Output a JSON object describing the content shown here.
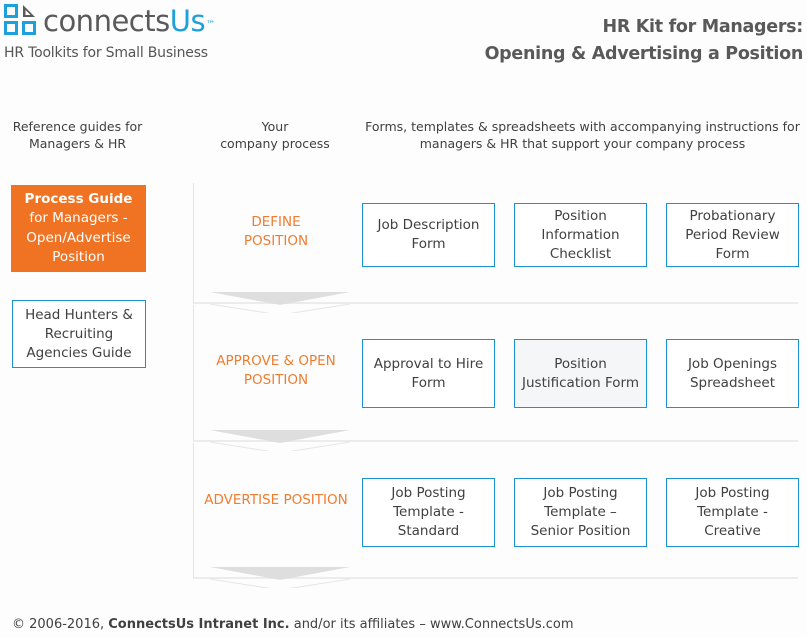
{
  "brand": {
    "name_prefix": "connects",
    "name_suffix": "Us",
    "trademark": "™",
    "tagline": "HR Toolkits for Small Business",
    "colors": {
      "blue": "#1ea0dc",
      "gray": "#5a5a5a"
    }
  },
  "header": {
    "title_line1": "HR Kit for Managers:",
    "title_line2": "Opening & Advertising a Position"
  },
  "column_headers": {
    "reference": [
      "Reference guides for",
      "Managers & HR"
    ],
    "process": [
      "Your",
      "company process"
    ],
    "forms": [
      "Forms, templates & spreadsheets with accompanying instructions for",
      "managers & HR that support your company process"
    ]
  },
  "reference_guides": {
    "primary": {
      "bold_line": "Process Guide",
      "lines": [
        "for Managers -",
        "Open/Advertise",
        "Position"
      ],
      "color": "#f07323"
    },
    "secondary": {
      "lines": [
        "Head Hunters &",
        "Recruiting",
        "Agencies Guide"
      ]
    }
  },
  "steps": [
    {
      "label_lines": [
        "DEFINE",
        "POSITION"
      ],
      "documents": [
        {
          "lines": [
            "Job Description",
            "Form"
          ]
        },
        {
          "lines": [
            "Position",
            "Information",
            "Checklist"
          ]
        },
        {
          "lines": [
            "Probationary",
            "Period Review",
            "Form"
          ]
        }
      ]
    },
    {
      "label_lines": [
        "APPROVE & OPEN",
        "POSITION"
      ],
      "documents": [
        {
          "lines": [
            "Approval to Hire",
            "Form"
          ]
        },
        {
          "lines": [
            "Position",
            "Justification Form"
          ],
          "highlighted": true
        },
        {
          "lines": [
            "Job Openings",
            "Spreadsheet"
          ]
        }
      ]
    },
    {
      "label_lines": [
        "ADVERTISE POSITION"
      ],
      "documents": [
        {
          "lines": [
            "Job Posting",
            "Template -",
            "Standard"
          ]
        },
        {
          "lines": [
            "Job Posting",
            "Template –",
            "Senior Position"
          ]
        },
        {
          "lines": [
            "Job Posting",
            "Template -",
            "Creative"
          ]
        }
      ]
    }
  ],
  "footer": {
    "prefix": "© 2006-2016, ",
    "company": "ConnectsUs Intranet Inc.",
    "suffix": " and/or its affiliates – www.ConnectsUs.com"
  },
  "colors": {
    "accent_orange": "#ed7d31",
    "card_border": "#1a93cf"
  }
}
